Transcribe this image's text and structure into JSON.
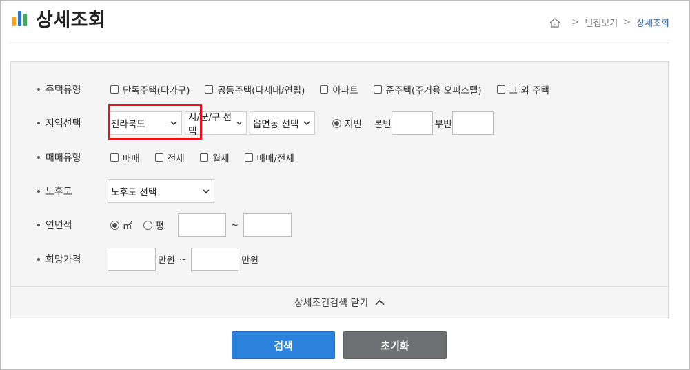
{
  "header": {
    "title": "상세조회",
    "breadcrumb": {
      "parent": "빈집보기",
      "current": "상세조회",
      "separator": ">"
    }
  },
  "filters": {
    "house_type": {
      "label": "주택유형",
      "options": [
        "단독주택(다가구)",
        "공동주택(다세대/연립)",
        "아파트",
        "준주택(주거용 오피스텔)",
        "그 외 주택"
      ]
    },
    "region": {
      "label": "지역선택",
      "province": "전라북도",
      "city": "시/군/구 선택",
      "town": "읍면동 선택",
      "lot_radio": "지번",
      "main_no_label": "본번",
      "sub_no_label": "부번",
      "main_no_value": "",
      "sub_no_value": ""
    },
    "trade_type": {
      "label": "매매유형",
      "options": [
        "매매",
        "전세",
        "월세",
        "매매/전세"
      ]
    },
    "age": {
      "label": "노후도",
      "select": "노후도 선택"
    },
    "area": {
      "label": "연면적",
      "unit_m2": "㎡",
      "unit_pyeong": "평",
      "tilde": "~",
      "min": "",
      "max": ""
    },
    "price": {
      "label": "희망가격",
      "unit": "만원",
      "tilde": "~",
      "min": "",
      "max": ""
    }
  },
  "panel": {
    "toggle_label": "상세조건검색 닫기"
  },
  "buttons": {
    "search": "검색",
    "reset": "초기화"
  },
  "colors": {
    "primary": "#2b82dc",
    "secondary": "#6d6f72",
    "highlight": "#e8141b"
  },
  "icons": {
    "home": "home-icon",
    "caret": "chevron-down-icon",
    "toggle": "chevron-up-icon"
  }
}
